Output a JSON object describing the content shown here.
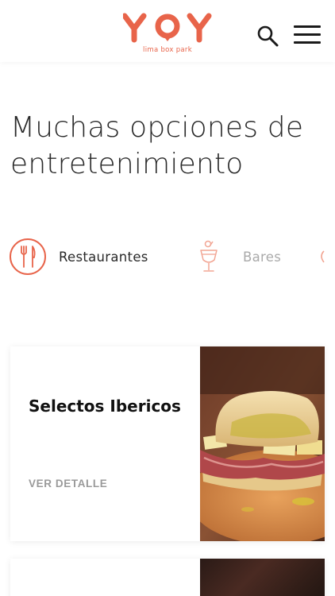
{
  "header": {
    "logo_text": "YOY",
    "logo_subtitle": "lima box park",
    "search_icon": "search-icon",
    "menu_icon": "hamburger-menu-icon"
  },
  "hero": {
    "title_line1": "Muchas opciones de",
    "title_line2": "entretenimiento"
  },
  "categories": [
    {
      "label": "Restaurantes",
      "icon": "fork-knife-icon",
      "active": true
    },
    {
      "label": "Bares",
      "icon": "cocktail-icon",
      "active": false
    },
    {
      "label": "",
      "icon": "partial-icon",
      "active": false
    }
  ],
  "cards": [
    {
      "title": "Selectos Ibericos",
      "link_label": "VER DETALLE",
      "image": "sandwich-photo"
    },
    {
      "title": "",
      "link_label": "",
      "image": "restaurant-photo"
    }
  ],
  "colors": {
    "accent": "#e8644a",
    "text": "#2a2a2a",
    "muted": "#9a9a9a"
  }
}
